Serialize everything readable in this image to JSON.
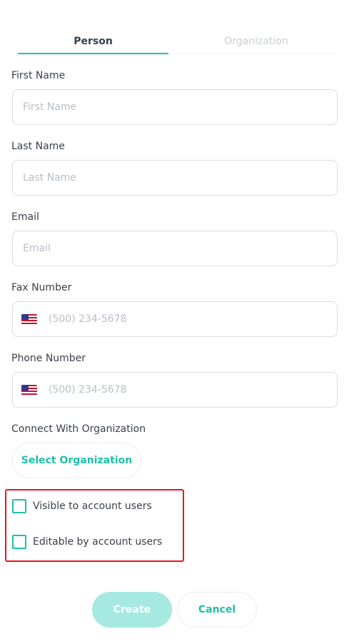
{
  "tabs": {
    "person": "Person",
    "organization": "Organization"
  },
  "fields": {
    "first_name": {
      "label": "First Name",
      "placeholder": "First Name"
    },
    "last_name": {
      "label": "Last Name",
      "placeholder": "Last Name"
    },
    "email": {
      "label": "Email",
      "placeholder": "Email"
    },
    "fax": {
      "label": "Fax Number",
      "placeholder": "(500) 234-5678"
    },
    "phone": {
      "label": "Phone Number",
      "placeholder": "(500) 234-5678"
    }
  },
  "organization": {
    "label": "Connect With Organization",
    "button": "Select Organization"
  },
  "checkboxes": {
    "visible": "Visible to account users",
    "editable": "Editable by account users"
  },
  "actions": {
    "create": "Create",
    "cancel": "Cancel"
  },
  "colors": {
    "accent": "#1fbfa9",
    "create_button": "#a6e9e0",
    "highlight": "#e8161c"
  },
  "icons": {
    "flag": "us-flag-icon"
  }
}
